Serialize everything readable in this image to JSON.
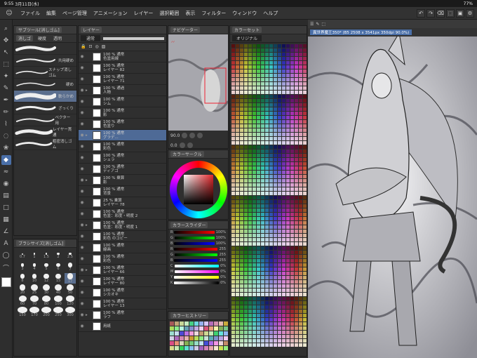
{
  "status": {
    "time": "9:55",
    "date": "3月11日(水)",
    "battery": "77%"
  },
  "menu": [
    "ファイル",
    "編集",
    "ページ管理",
    "アニメーション",
    "レイヤー",
    "選択範囲",
    "表示",
    "フィルター",
    "ウィンドウ",
    "ヘルプ"
  ],
  "subtool": {
    "tabs": [
      "サブツール[消しゴム]",
      "消しゴ",
      "硬度",
      "透明"
    ],
    "brushes": [
      "",
      "共用硬め",
      "スナップ消しゴム",
      "硬め",
      "軟らかめ",
      "ざっくり",
      "ベクター用",
      "レイヤー貫通",
      "粗密消しゴム"
    ],
    "selected_index": 4
  },
  "brushsize": {
    "title": "ブラシサイズ[消しゴム]",
    "sizes": [
      "0.7",
      "1",
      "1.5",
      "2",
      "2.5",
      "3",
      "4",
      "5",
      "6",
      "7",
      "8",
      "10",
      "12",
      "15",
      "17",
      "20",
      "25",
      "30",
      "40",
      "50",
      "60",
      "70",
      "80",
      "100",
      "120",
      "150",
      "170",
      "200",
      "250",
      "300"
    ]
  },
  "layers": {
    "title": "レイヤー",
    "blend": "通常",
    "rows": [
      {
        "t": "100 % 通常",
        "s": "色塗用線"
      },
      {
        "t": "100 % 通常",
        "s": "レイヤー 82"
      },
      {
        "t": "100 % 通常",
        "s": "レイヤー 71"
      },
      {
        "t": "100 % 通過",
        "s": "人物"
      },
      {
        "t": "100 % 通常",
        "s": "シム"
      },
      {
        "t": "100 % 通常",
        "s": "影"
      },
      {
        "t": "100 % 通常",
        "s": "色塗り"
      },
      {
        "t": "100 % 通常",
        "s": "グラデ..."
      },
      {
        "t": "100 % 通常",
        "s": "彩色"
      },
      {
        "t": "100 % 通常",
        "s": "シェラ"
      },
      {
        "t": "100 % 通常",
        "s": "ディアゴ"
      },
      {
        "t": "100 % 乗算",
        "s": "影"
      },
      {
        "t": "100 % 通常",
        "s": "背景"
      },
      {
        "t": "25 % 乗算",
        "s": "レイヤー 78"
      },
      {
        "t": "100 % 通常",
        "s": "色塗：彩度・明度 2"
      },
      {
        "t": "100 % 通常",
        "s": "色塗：彩度・明度 1"
      },
      {
        "t": "100 % 通常",
        "s": "彩色 のコピー"
      },
      {
        "t": "100 % 通常",
        "s": "線画"
      },
      {
        "t": "100 % 通常",
        "s": "彩色"
      },
      {
        "t": "100 % 通常",
        "s": "レイヤー 66"
      },
      {
        "t": "100 % 通常",
        "s": "レイヤー 80"
      },
      {
        "t": "100 % 通常",
        "s": "シカオキ"
      },
      {
        "t": "100 % 通常",
        "s": "レイヤー 13"
      },
      {
        "t": "100 % 通常",
        "s": "ラフ"
      },
      {
        "t": "",
        "s": "用紙"
      }
    ],
    "selected_index": 7
  },
  "navigator": {
    "title": "ナビゲーター",
    "zoom": "90.0",
    "angle": "0.0"
  },
  "colorcircle": {
    "title": "カラーサークル",
    "values": "0  M  0  B  100"
  },
  "colorslider": {
    "title": "カラースライダー",
    "rows": [
      {
        "k": "R",
        "v": "100%"
      },
      {
        "k": "G",
        "v": "100%"
      },
      {
        "k": "B",
        "v": "100%"
      },
      {
        "k": "R",
        "v": "255"
      },
      {
        "k": "G",
        "v": "255"
      },
      {
        "k": "B",
        "v": "255"
      },
      {
        "k": "C",
        "v": "0%"
      },
      {
        "k": "M",
        "v": "0%"
      },
      {
        "k": "Y",
        "v": "0%"
      },
      {
        "k": "K",
        "v": "0%"
      }
    ]
  },
  "colorhistory": {
    "title": "カラーヒストリー"
  },
  "colorset": {
    "title": "カラーセット",
    "name": "オリジナル"
  },
  "canvas": {
    "tab": "異世界魔王350* (B5 2508 x 3541px 350dpi 90.0%)"
  }
}
